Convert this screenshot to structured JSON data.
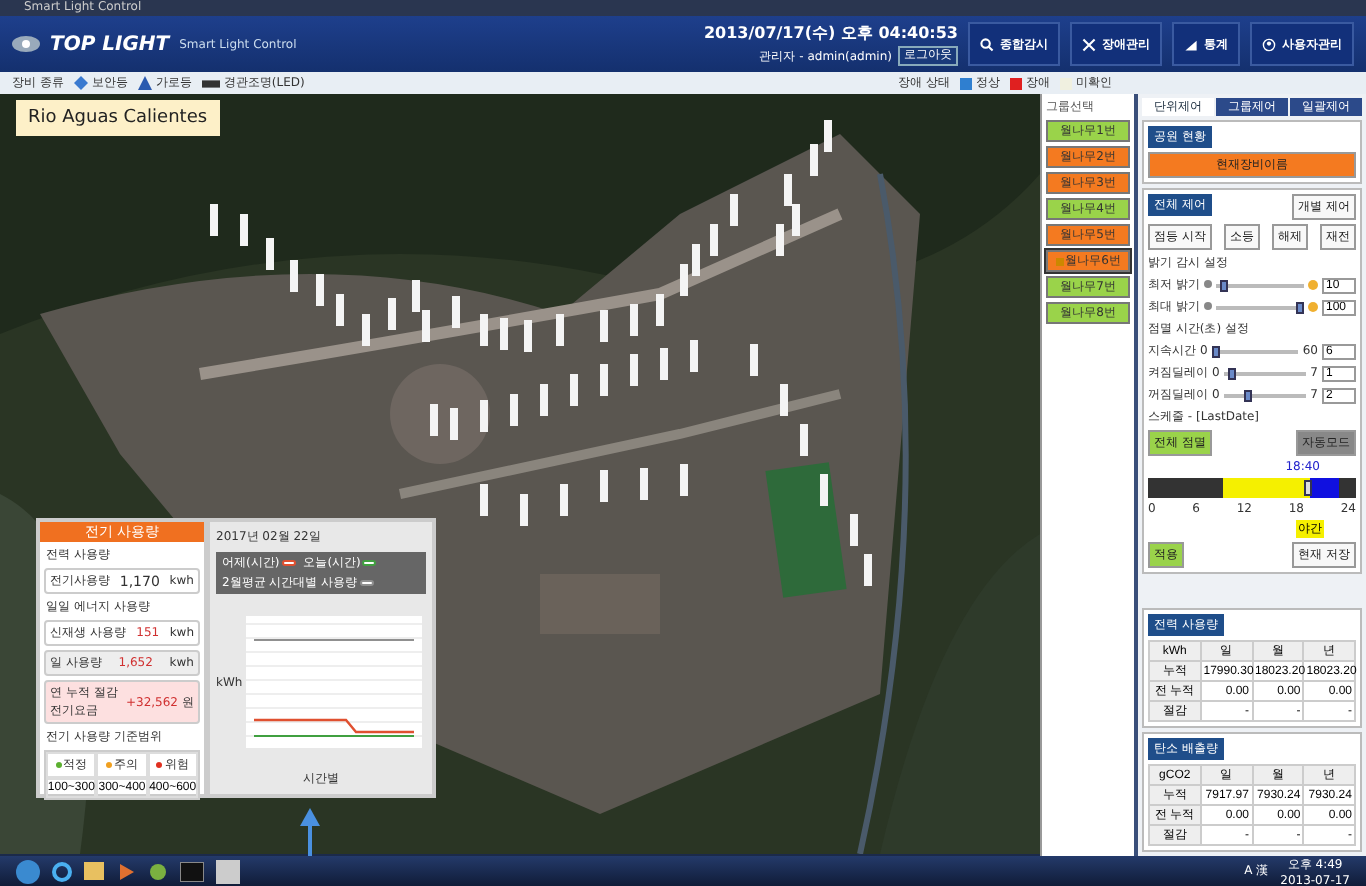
{
  "window": {
    "title": "Smart Light Control"
  },
  "header": {
    "logo": "TOP LIGHT",
    "subtitle": "Smart Light Control",
    "datetime": "2013/07/17(수) 오후 04:40:53",
    "user": "관리자 - admin(admin)",
    "logout": "로그아웃",
    "nav": [
      {
        "label": "종합감시"
      },
      {
        "label": "장애관리"
      },
      {
        "label": "통계"
      },
      {
        "label": "사용자관리"
      }
    ]
  },
  "toolbar": {
    "label": "장비 종류",
    "types": [
      {
        "label": "보안등",
        "kind": "diamond"
      },
      {
        "label": "가로등",
        "kind": "triangle"
      },
      {
        "label": "경관조명(LED)",
        "kind": "bar"
      }
    ],
    "status_label": "장애 상태",
    "legend": [
      {
        "label": "정상",
        "color": "#2f7fd0"
      },
      {
        "label": "장애",
        "color": "#e02020"
      },
      {
        "label": "미확인",
        "color": "#f0f0e0"
      }
    ]
  },
  "map": {
    "place_label": "Rio Aguas Calientes"
  },
  "device_list": {
    "header": "그룹선택",
    "items": [
      {
        "label": "월나무1번",
        "color": "#9ad34a",
        "selected": false
      },
      {
        "label": "월나무2번",
        "color": "#f47a20",
        "selected": false
      },
      {
        "label": "월나무3번",
        "color": "#f47a20",
        "selected": false
      },
      {
        "label": "월나무4번",
        "color": "#9ad34a",
        "selected": false
      },
      {
        "label": "월나무5번",
        "color": "#f47a20",
        "selected": false
      },
      {
        "label": "월나무6번",
        "color": "#f47a20",
        "selected": true
      },
      {
        "label": "월나무7번",
        "color": "#9ad34a",
        "selected": false
      },
      {
        "label": "월나무8번",
        "color": "#9ad34a",
        "selected": false
      }
    ]
  },
  "control_panel": {
    "tabs": [
      {
        "label": "단위제어",
        "selected": true
      },
      {
        "label": "그룹제어",
        "selected": false
      },
      {
        "label": "일괄제어",
        "selected": false
      }
    ],
    "group_title": "공원 현황",
    "device_button": "현재장비이름",
    "control_title": "전체 제어",
    "mode_button": "개별 제어",
    "buttons": [
      "점등 시작",
      "소등",
      "해제",
      "재전"
    ],
    "dimming_title": "밝기 감시 설정",
    "dimming": [
      {
        "label": "최저 밝기",
        "level": 0.1,
        "value": "10"
      },
      {
        "label": "최대 밝기",
        "level": 0.95,
        "value": "100"
      }
    ],
    "timing_title": "점멸 시간(초) 설정",
    "timing": [
      {
        "label": "지속시간",
        "min": "0",
        "max": "60",
        "level": 0.05,
        "value": "6"
      },
      {
        "label": "켜짐딜레이",
        "min": "0",
        "max": "7",
        "level": 0.1,
        "value": "1"
      },
      {
        "label": "꺼짐딜레이",
        "min": "0",
        "max": "7",
        "level": 0.3,
        "value": "2"
      }
    ],
    "schedule_title": "스케줄 - [LastDate]",
    "all_button": "전체 점멸",
    "auto_button": "자동모드",
    "time": "18:40",
    "level": 0.77,
    "ticks": [
      "0",
      "6",
      "12",
      "18",
      "24"
    ],
    "tag": "야간",
    "apply_button": "적용",
    "save_button": "현재 저장"
  },
  "usage_table": {
    "title": "전력 사용량",
    "columns": [
      "kWh",
      "일",
      "월",
      "년"
    ],
    "rows": [
      [
        "누적",
        "17990.30",
        "18023.20",
        "18023.20"
      ],
      [
        "전 누적",
        "0.00",
        "0.00",
        "0.00"
      ],
      [
        "절감",
        "-",
        "-",
        "-"
      ]
    ]
  },
  "co2_table": {
    "title": "탄소 배출량",
    "columns": [
      "gCO2",
      "일",
      "월",
      "년"
    ],
    "rows": [
      [
        "누적",
        "7917.97",
        "7930.24",
        "7930.24"
      ],
      [
        "전 누적",
        "0.00",
        "0.00",
        "0.00"
      ],
      [
        "절감",
        "-",
        "-",
        "-"
      ]
    ]
  },
  "usage_popup": {
    "title": "전기 사용량",
    "total_label": "전력 사용량",
    "total_caption": "전기사용량",
    "total_value": "1,170",
    "unit": "kwh",
    "daily_label": "일일 에너지 사용량",
    "rows": [
      {
        "label": "신재생 사용량",
        "value": "151",
        "unit": "kwh"
      },
      {
        "label": "일 사용량",
        "value": "1,652",
        "unit": "kwh"
      },
      {
        "label": "연 누적 절감 전기요금",
        "value": "+32,562",
        "unit": "원"
      }
    ],
    "range_label": "전기 사용량 기준범위",
    "levels": [
      {
        "label": "적정",
        "color": "#5cb030",
        "range": "100~300"
      },
      {
        "label": "주의",
        "color": "#f0a020",
        "range": "300~400"
      },
      {
        "label": "위험",
        "color": "#e03020",
        "range": "400~600"
      }
    ],
    "chart_date": "2017년 02월 22일",
    "legend": [
      {
        "label": "어제(시간)",
        "color": "#e05030"
      },
      {
        "label": "오늘(시간)",
        "color": "#40a040"
      },
      {
        "label": "2월평균 시간대별 사용량",
        "color": "#909090"
      }
    ],
    "ylabel": "kWh",
    "xlabel": "시간별"
  },
  "taskbar": {
    "ime": "A 漢",
    "time": "오후 4:49",
    "date": "2013-07-17"
  }
}
